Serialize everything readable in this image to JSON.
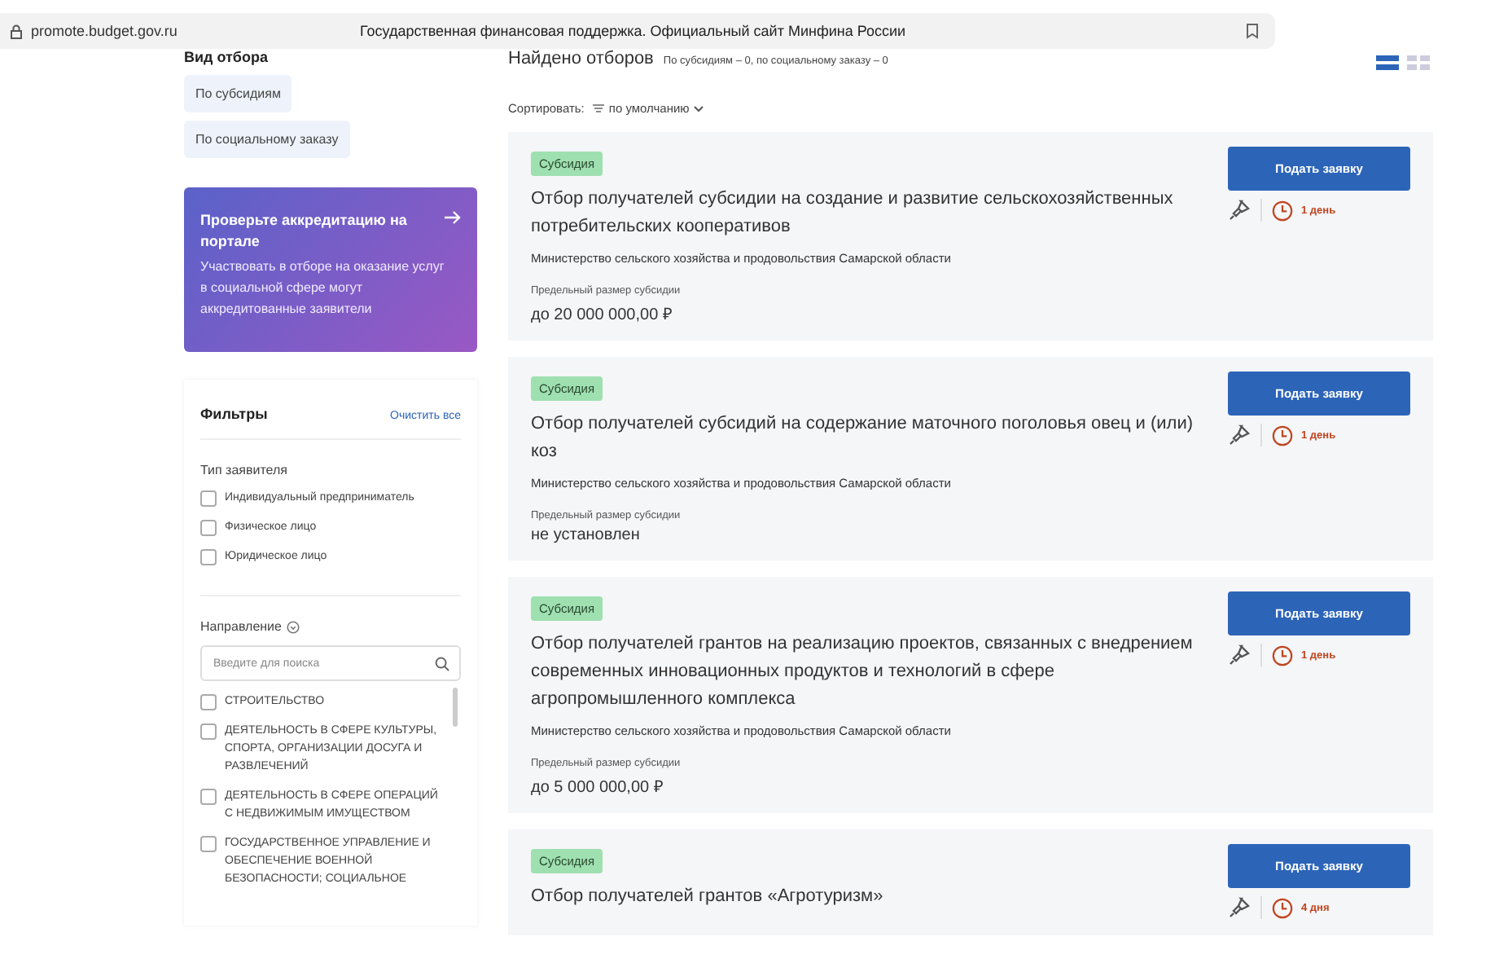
{
  "browser": {
    "url": "promote.budget.gov.ru",
    "title": "Государственная финансовая поддержка. Официальный сайт Минфина России"
  },
  "sidebar": {
    "heading": "Вид отбора",
    "types": [
      {
        "label": "По субсидиям",
        "selected": false
      },
      {
        "label": "По социальному заказу",
        "selected": false
      }
    ],
    "banner": {
      "title": "Проверьте аккредитацию на портале",
      "text": "Участвовать в отборе на оказание услуг в социальной сфере могут аккредитованные заявители"
    },
    "filters": {
      "title": "Фильтры",
      "clear": "Очистить все",
      "applicant_label": "Тип заявителя",
      "applicant_types": [
        {
          "label": "Индивидуальный предприниматель",
          "checked": false
        },
        {
          "label": "Физическое лицо",
          "checked": false
        },
        {
          "label": "Юридическое лицо",
          "checked": false
        }
      ],
      "direction_label": "Направление",
      "search": {
        "placeholder": "Введите для поиска"
      },
      "directions": [
        {
          "label": "СТРОИТЕЛЬСТВО",
          "checked": false
        },
        {
          "label": "ДЕЯТЕЛЬНОСТЬ В СФЕРЕ КУЛЬТУРЫ, СПОРТА, ОРГАНИЗАЦИИ ДОСУГА И РАЗВЛЕЧЕНИЙ",
          "checked": false
        },
        {
          "label": "ДЕЯТЕЛЬНОСТЬ В СФЕРЕ ОПЕРАЦИЙ С НЕДВИЖИМЫМ ИМУЩЕСТВОМ",
          "checked": false
        },
        {
          "label": "ГОСУДАРСТВЕННОЕ УПРАВЛЕНИЕ И ОБЕСПЕЧЕНИЕ ВОЕННОЙ БЕЗОПАСНОСТИ; СОЦИАЛЬНОЕ",
          "checked": false
        }
      ]
    }
  },
  "results": {
    "heading": "Найдено отборов",
    "summary": "По субсидиям – 0, по социальному заказу – 0",
    "view_toggle": [
      {
        "selected": true
      },
      {
        "selected": false
      }
    ],
    "sort_label": "Сортировать:",
    "sort_value": "по умолчанию",
    "cards": [
      {
        "tag": "Субсидия",
        "title": "Отбор получателей субсидии на создание и развитие сельскохозяйственных потребительских кооперативов",
        "org": "Министерство сельского хозяйства и продовольствия Самарской области",
        "limit_label": "Предельный размер субсидии",
        "limit": "до 20 000 000,00 ₽",
        "button": "Подать заявку",
        "deadline": "1 день"
      },
      {
        "tag": "Субсидия",
        "title": "Отбор получателей субсидий на содержание маточного поголовья овец и (или) коз",
        "org": "Министерство сельского хозяйства и продовольствия Самарской области",
        "limit_label": "Предельный размер субсидии",
        "limit": "не установлен",
        "button": "Подать заявку",
        "deadline": "1 день"
      },
      {
        "tag": "Субсидия",
        "title": "Отбор получателей грантов на реализацию проектов, связанных с внедрением современных инновационных продуктов и технологий в сфере агропромышленного комплекса",
        "org": "Министерство сельского хозяйства и продовольствия Самарской области",
        "limit_label": "Предельный размер субсидии",
        "limit": "до 5 000 000,00 ₽",
        "button": "Подать заявку",
        "deadline": "1 день"
      },
      {
        "tag": "Субсидия",
        "title": "Отбор получателей грантов «Агротуризм»",
        "button": "Подать заявку",
        "deadline": "4 дня"
      }
    ]
  }
}
